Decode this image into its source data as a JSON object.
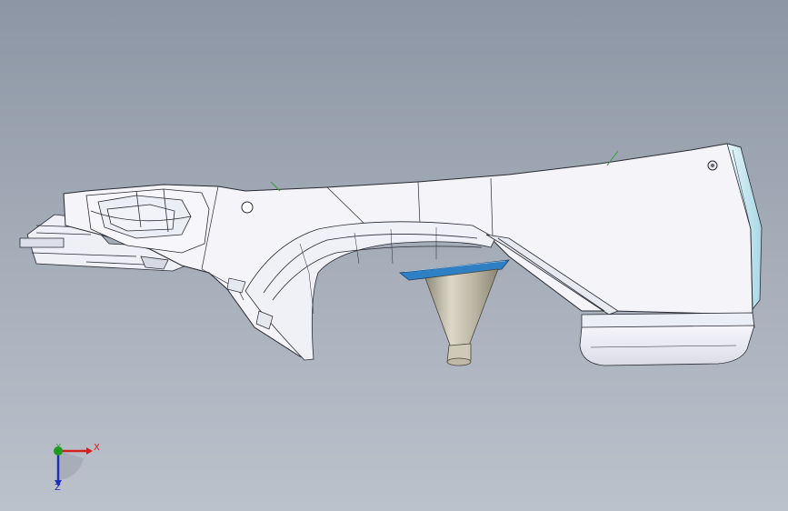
{
  "viewport": {
    "background_top": "#8c96a4",
    "background_bottom": "#bcc2cc"
  },
  "model": {
    "body_color": "#f4f4f9",
    "edge_color": "#2a2a33",
    "accent_cyan": "#bfe3ee",
    "hole_blue": "#2e7fc4",
    "funnel_color": "#cfc9b8"
  },
  "triad": {
    "x_label": "X",
    "y_label": "Y",
    "z_label": "Z",
    "x_color": "#d42020",
    "y_color": "#1f9a1f",
    "z_color": "#1f2fb8"
  }
}
